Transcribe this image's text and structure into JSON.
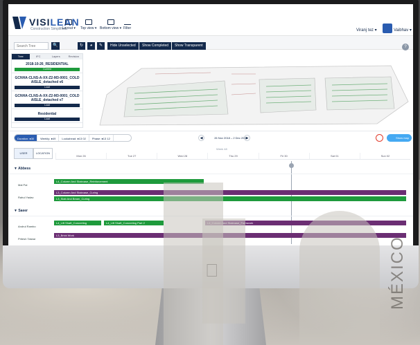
{
  "app": {
    "logo_brand_a": "VISI",
    "logo_brand_b": "LEAN",
    "logo_tagline": "Construction Simplified"
  },
  "toolbar": {
    "layout_label": "Layout",
    "top_view_label": "Top view",
    "bottom_view_label": "Bottom view",
    "filter_label": "Filter",
    "user_name": "Viranj tez",
    "account_name": "Vaibhav"
  },
  "actions": {
    "search_placeholder": "Search Tree",
    "hide_unselected": "Hide Unselected",
    "show_completed": "Show Completed",
    "show_transparent": "Show Transparent"
  },
  "sidebar": {
    "tabs": [
      "Tree",
      "IFC",
      "Layers",
      "Revision"
    ],
    "items": [
      {
        "title": "2018-10-26_RESIDENTIAL",
        "badge": "Current"
      },
      {
        "title": "GCNHA-CLNS-A-XX-Z2-M3-0001_COLD AISLE_detached v6",
        "badge": "Load"
      },
      {
        "title": "GCNHA-CLNS-A-XX-Z2-M3-0001_COLD AISLE_detached v7",
        "badge": "Load"
      },
      {
        "title": "Residential",
        "badge": "Load"
      }
    ]
  },
  "filters": {
    "items": [
      "Duration: ●30",
      "Weekly: ●49",
      "Lookahead: ●13 02",
      "Phase: ●13 12"
    ],
    "date_range": "26 Nov 2018 – 2 Dec 2018",
    "map_button": "Show map"
  },
  "gantt": {
    "mode_tabs": [
      "USER",
      "LOCATION"
    ],
    "week_label": "Week 48",
    "days": [
      "Mon 26",
      "Tue 27",
      "Wed 28",
      "Thu 29",
      "Fri 30",
      "Sat 01",
      "Sun 02"
    ],
    "groups": [
      {
        "name": "Abbess",
        "rows": [
          "Mal Pal",
          "Rahul Yadav"
        ]
      },
      {
        "name": "Saeer",
        "rows": [
          "Andrul Rambo",
          "Pritesh Tatwar"
        ]
      }
    ],
    "bars": {
      "b1": "L4_Column And Staircase_Reinforcement",
      "b2": "L3_Column And Staircase_Curing",
      "b3": "L3_Slab And Beam_Curing",
      "b4": "L4_Lift Shaft_Concreting",
      "b5": "L4_Lift Shaft_Concreting Part 2",
      "b6": "L4_Column And Staircase_Formwork",
      "b7": "L3_Brick Work"
    }
  },
  "watermark": {
    "text": "MÉXICO"
  },
  "colors": {
    "navy": "#13294b",
    "green": "#1e9a3c",
    "purple": "#6b2e73",
    "accent_blue": "#45a9f2"
  }
}
